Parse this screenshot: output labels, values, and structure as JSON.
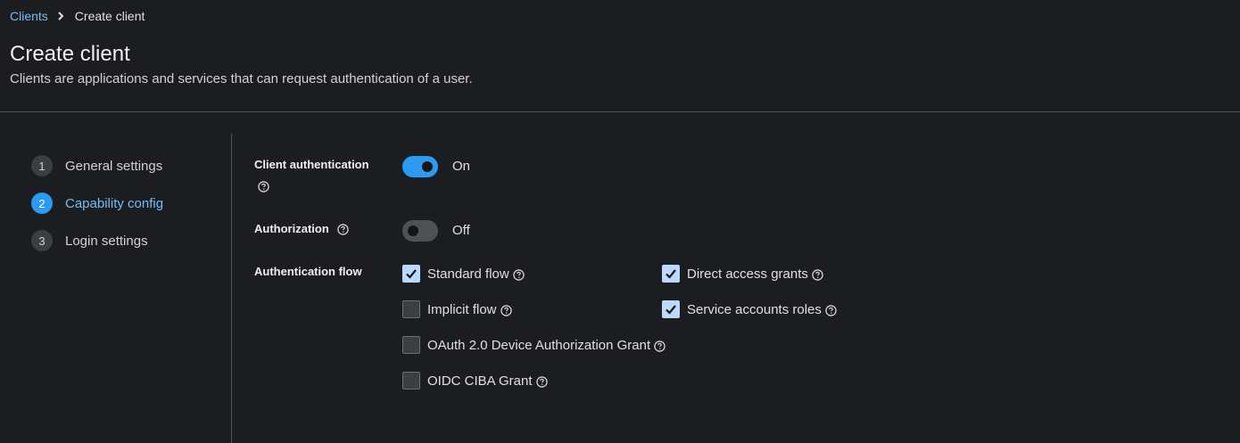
{
  "breadcrumb": {
    "parent": "Clients",
    "current": "Create client"
  },
  "page": {
    "title": "Create client",
    "description": "Clients are applications and services that can request authentication of a user."
  },
  "wizard": {
    "steps": [
      {
        "number": "1",
        "label": "General settings",
        "active": false
      },
      {
        "number": "2",
        "label": "Capability config",
        "active": true
      },
      {
        "number": "3",
        "label": "Login settings",
        "active": false
      }
    ]
  },
  "form": {
    "client_authentication": {
      "label": "Client authentication",
      "state": "On",
      "enabled": true
    },
    "authorization": {
      "label": "Authorization",
      "state": "Off",
      "enabled": false
    },
    "authentication_flow": {
      "label": "Authentication flow",
      "options": [
        {
          "label": "Standard flow",
          "checked": true
        },
        {
          "label": "Direct access grants",
          "checked": true
        },
        {
          "label": "Implicit flow",
          "checked": false
        },
        {
          "label": "Service accounts roles",
          "checked": true
        },
        {
          "label": "OAuth 2.0 Device Authorization Grant",
          "checked": false
        },
        {
          "label": "OIDC CIBA Grant",
          "checked": false
        }
      ]
    }
  },
  "colors": {
    "background": "#1b1d21",
    "accent": "#2b9af3",
    "link": "#73bcf7",
    "checkbox_checked": "#b9dafc"
  },
  "icons": {
    "breadcrumb_separator": "chevron-right-icon",
    "help": "question-circle-icon",
    "check": "checkmark-icon"
  }
}
